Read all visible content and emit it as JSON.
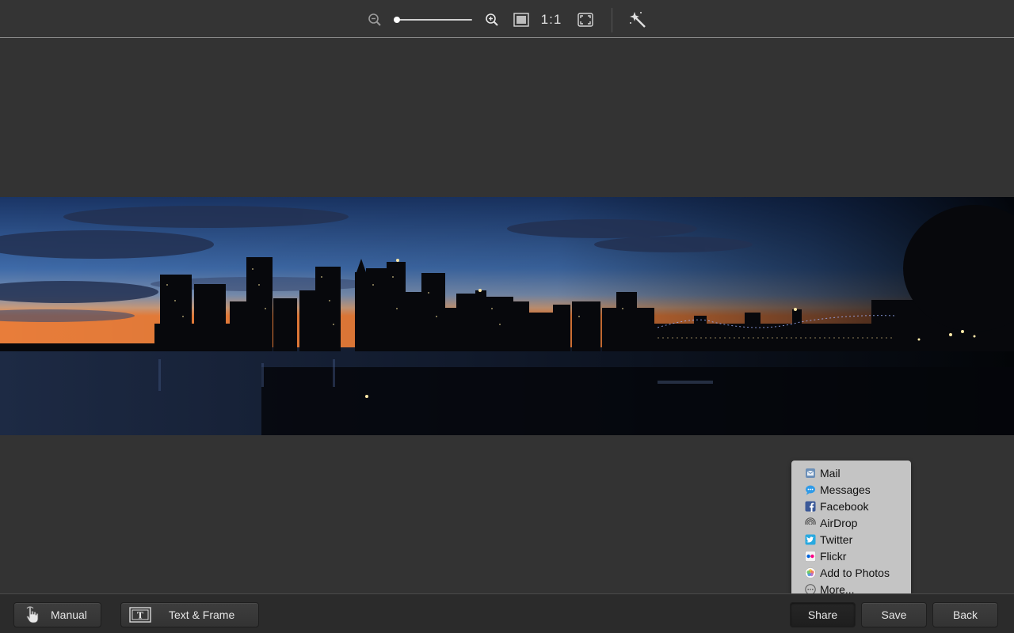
{
  "toolbar": {
    "zoom_level": 0,
    "actual_size_label": "1:1",
    "icons": [
      "zoom-out-icon",
      "zoom-in-icon",
      "fit-icon",
      "fullscreen-icon",
      "magic-wand-icon"
    ]
  },
  "share_menu": {
    "items": [
      {
        "label": "Mail",
        "icon": "mail-icon"
      },
      {
        "label": "Messages",
        "icon": "messages-icon"
      },
      {
        "label": "Facebook",
        "icon": "facebook-icon"
      },
      {
        "label": "AirDrop",
        "icon": "airdrop-icon"
      },
      {
        "label": "Twitter",
        "icon": "twitter-icon"
      },
      {
        "label": "Flickr",
        "icon": "flickr-icon"
      },
      {
        "label": "Add to Photos",
        "icon": "photos-icon"
      },
      {
        "label": "More...",
        "icon": "more-icon"
      }
    ]
  },
  "bottom_bar": {
    "manual_label": "Manual",
    "text_frame_label": "Text & Frame",
    "share_label": "Share",
    "save_label": "Save",
    "back_label": "Back"
  }
}
